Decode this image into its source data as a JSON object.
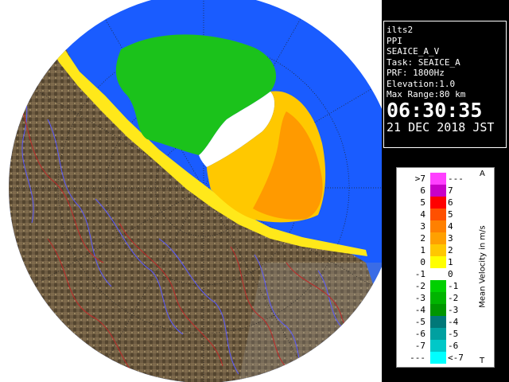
{
  "info": {
    "site": "ilts2",
    "product": "PPI",
    "field": "SEAICE_A_V",
    "task": "Task: SEAICE_A",
    "prf": "PRF: 1800Hz",
    "elevation": "Elevation:1.0",
    "max_range": "Max Range:80 km",
    "time": "06:30:35",
    "date": "21 DEC 2018 JST"
  },
  "legend": {
    "title": "Mean Velocity in m/s",
    "marker_top": "A",
    "marker_bottom": "T",
    "rows": [
      {
        "left": ">7",
        "right": "---",
        "color": "#ff40ff"
      },
      {
        "left": "6",
        "right": "7",
        "color": "#c800c8"
      },
      {
        "left": "5",
        "right": "6",
        "color": "#ff0000"
      },
      {
        "left": "4",
        "right": "5",
        "color": "#ff5000"
      },
      {
        "left": "3",
        "right": "4",
        "color": "#ff8000"
      },
      {
        "left": "2",
        "right": "3",
        "color": "#ffa000"
      },
      {
        "left": "1",
        "right": "2",
        "color": "#ffc800"
      },
      {
        "left": "0",
        "right": "1",
        "color": "#ffff00"
      },
      {
        "left": "-1",
        "right": "0",
        "color": "#ffffff"
      },
      {
        "left": "-2",
        "right": "-1",
        "color": "#00d000"
      },
      {
        "left": "-3",
        "right": "-2",
        "color": "#00b400"
      },
      {
        "left": "-4",
        "right": "-3",
        "color": "#009600"
      },
      {
        "left": "-5",
        "right": "-4",
        "color": "#007878"
      },
      {
        "left": "-6",
        "right": "-5",
        "color": "#00a0a0"
      },
      {
        "left": "-7",
        "right": "-6",
        "color": "#00c8c8"
      },
      {
        "left": "---",
        "right": "<-7",
        "color": "#00ffff"
      }
    ]
  },
  "colors": {
    "sea": "#1a5cff",
    "land": "#6b5a40",
    "background": "#000000",
    "out_of_range": "#ffffff"
  }
}
